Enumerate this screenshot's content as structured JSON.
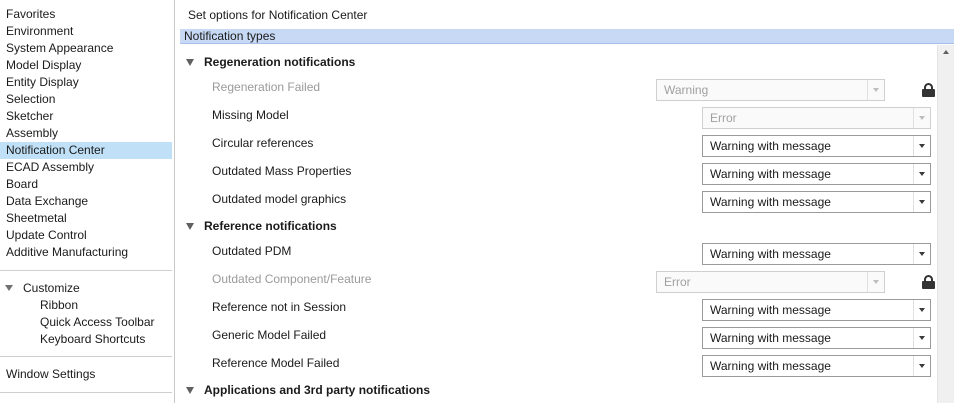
{
  "sidebar": {
    "items": [
      {
        "label": "Favorites"
      },
      {
        "label": "Environment"
      },
      {
        "label": "System Appearance"
      },
      {
        "label": "Model Display"
      },
      {
        "label": "Entity Display"
      },
      {
        "label": "Selection"
      },
      {
        "label": "Sketcher"
      },
      {
        "label": "Assembly"
      },
      {
        "label": "Notification Center",
        "selected": true
      },
      {
        "label": "ECAD Assembly"
      },
      {
        "label": "Board"
      },
      {
        "label": "Data Exchange"
      },
      {
        "label": "Sheetmetal"
      },
      {
        "label": "Update Control"
      },
      {
        "label": "Additive Manufacturing"
      }
    ],
    "customize": {
      "label": "Customize",
      "children": [
        {
          "label": "Ribbon"
        },
        {
          "label": "Quick Access Toolbar"
        },
        {
          "label": "Keyboard Shortcuts"
        }
      ]
    },
    "window_settings": "Window Settings"
  },
  "main": {
    "title": "Set options for Notification Center",
    "types_header": "Notification types",
    "sections": [
      {
        "label": "Regeneration notifications",
        "rows": [
          {
            "label": "Regeneration Failed",
            "value": "Warning",
            "disabled": true,
            "locked": true
          },
          {
            "label": "Missing Model",
            "value": "Error",
            "disabled": true,
            "locked": false
          },
          {
            "label": "Circular references",
            "value": "Warning with message",
            "disabled": false,
            "locked": false
          },
          {
            "label": "Outdated Mass Properties",
            "value": "Warning with message",
            "disabled": false,
            "locked": false
          },
          {
            "label": "Outdated model graphics",
            "value": "Warning with message",
            "disabled": false,
            "locked": false
          }
        ]
      },
      {
        "label": "Reference notifications",
        "rows": [
          {
            "label": "Outdated PDM",
            "value": "Warning with message",
            "disabled": false,
            "locked": false
          },
          {
            "label": "Outdated Component/Feature",
            "value": "Error",
            "disabled": true,
            "locked": true
          },
          {
            "label": "Reference not in Session",
            "value": "Warning with message",
            "disabled": false,
            "locked": false
          },
          {
            "label": "Generic Model Failed",
            "value": "Warning with message",
            "disabled": false,
            "locked": false
          },
          {
            "label": "Reference Model Failed",
            "value": "Warning with message",
            "disabled": false,
            "locked": false
          }
        ]
      },
      {
        "label": "Applications and 3rd party notifications",
        "rows": []
      }
    ]
  },
  "colors": {
    "selection": "#bfe0f7",
    "types_bar": "#c7d9f5",
    "disabled_text": "#9a9a9a"
  }
}
